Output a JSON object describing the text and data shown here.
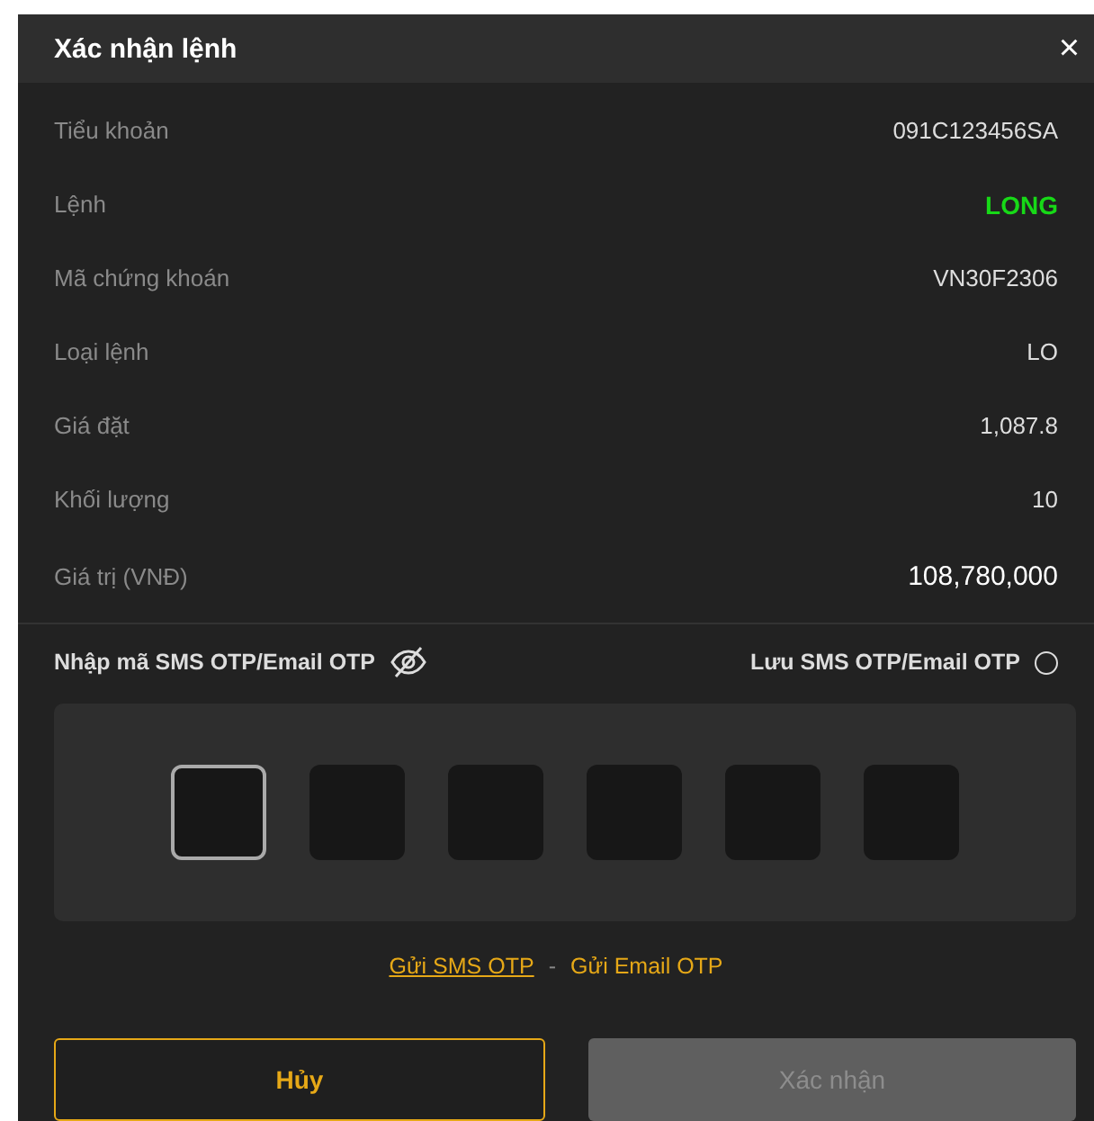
{
  "dialog": {
    "title": "Xác nhận lệnh",
    "close": "×"
  },
  "details": [
    {
      "label": "Tiểu khoản",
      "value": "091C123456SA",
      "kind": "plain"
    },
    {
      "label": "Lệnh",
      "value": "LONG",
      "kind": "side"
    },
    {
      "label": "Mã chứng khoán",
      "value": "VN30F2306",
      "kind": "plain"
    },
    {
      "label": "Loại lệnh",
      "value": "LO",
      "kind": "plain"
    },
    {
      "label": "Giá đặt",
      "value": "1,087.8",
      "kind": "plain"
    },
    {
      "label": "Khối lượng",
      "value": "10",
      "kind": "plain"
    },
    {
      "label": "Giá trị (VNĐ)",
      "value": "108,780,000",
      "kind": "total"
    }
  ],
  "otp": {
    "label": "Nhập mã SMS OTP/Email OTP",
    "visible": false,
    "save_label": "Lưu SMS OTP/Email OTP",
    "save_checked": false,
    "digits": [
      {
        "selected": true
      },
      {
        "selected": false
      },
      {
        "selected": false
      },
      {
        "selected": false
      },
      {
        "selected": false
      },
      {
        "selected": false
      }
    ]
  },
  "send_links": [
    {
      "label": "Gửi SMS OTP",
      "underlined": true
    },
    {
      "label": "Gửi Email OTP",
      "underlined": false
    }
  ],
  "separator": "-",
  "buttons": [
    {
      "label": "Hủy",
      "kind": "cancel",
      "disabled": false
    },
    {
      "label": "Xác nhận",
      "kind": "confirm",
      "disabled": true
    }
  ]
}
